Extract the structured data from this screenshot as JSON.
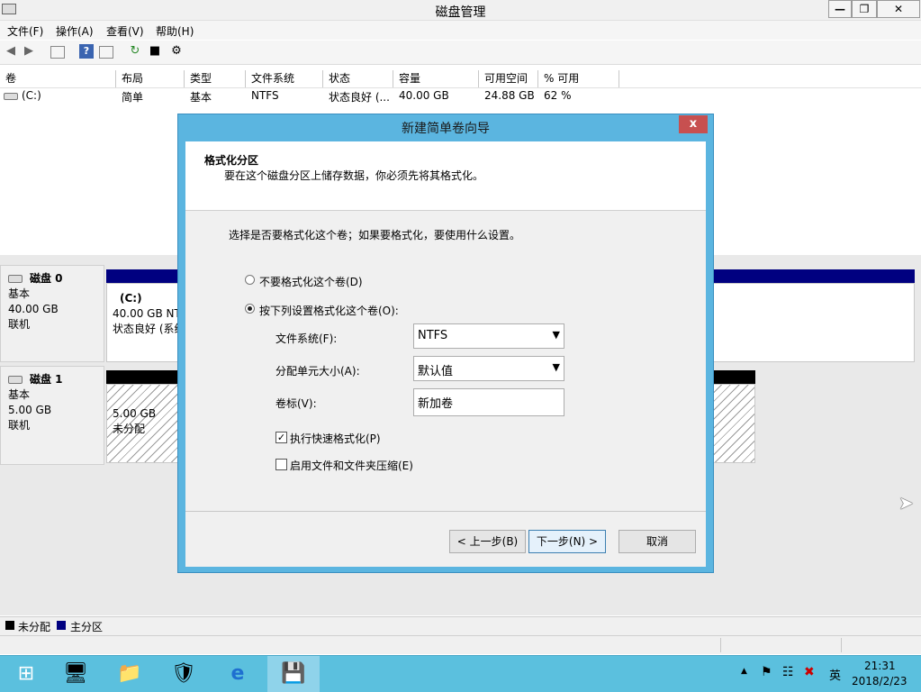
{
  "window": {
    "title": "磁盘管理"
  },
  "menu": [
    "文件(F)",
    "操作(A)",
    "查看(V)",
    "帮助(H)"
  ],
  "volume_table": {
    "headers": [
      "卷",
      "布局",
      "类型",
      "文件系统",
      "状态",
      "容量",
      "可用空间",
      "% 可用"
    ],
    "rows": [
      [
        "(C:)",
        "简单",
        "基本",
        "NTFS",
        "状态良好 (...",
        "40.00 GB",
        "24.88 GB",
        "62 %"
      ]
    ]
  },
  "disks": [
    {
      "name": "磁盘 0",
      "type": "基本",
      "size": "40.00 GB",
      "status": "联机",
      "partition": {
        "label": "(C:)",
        "size": "40.00 GB NT",
        "status": "状态良好 (系统"
      }
    },
    {
      "name": "磁盘 1",
      "type": "基本",
      "size": "5.00 GB",
      "status": "联机",
      "partition": {
        "size": "5.00 GB",
        "status": "未分配"
      }
    }
  ],
  "legend": {
    "unallocated": "未分配",
    "primary": "主分区",
    "unallocated_color": "#000000",
    "primary_color": "#000080"
  },
  "dialog": {
    "title": "新建简单卷向导",
    "close": "x",
    "heading": "格式化分区",
    "subheading": "要在这个磁盘分区上储存数据，你必须先将其格式化。",
    "prompt": "选择是否要格式化这个卷；如果要格式化，要使用什么设置。",
    "radio_no_format": "不要格式化这个卷(D)",
    "radio_format": "按下列设置格式化这个卷(O):",
    "fs_label": "文件系统(F):",
    "fs_value": "NTFS",
    "alloc_label": "分配单元大小(A):",
    "alloc_value": "默认值",
    "vol_label": "卷标(V):",
    "vol_value": "新加卷",
    "quick_format": "执行快速格式化(P)",
    "compression": "启用文件和文件夹压缩(E)",
    "back": "< 上一步(B)",
    "next": "下一步(N) >",
    "cancel": "取消"
  },
  "tray": {
    "time": "21:31",
    "date": "2018/2/23",
    "ime": "英"
  }
}
